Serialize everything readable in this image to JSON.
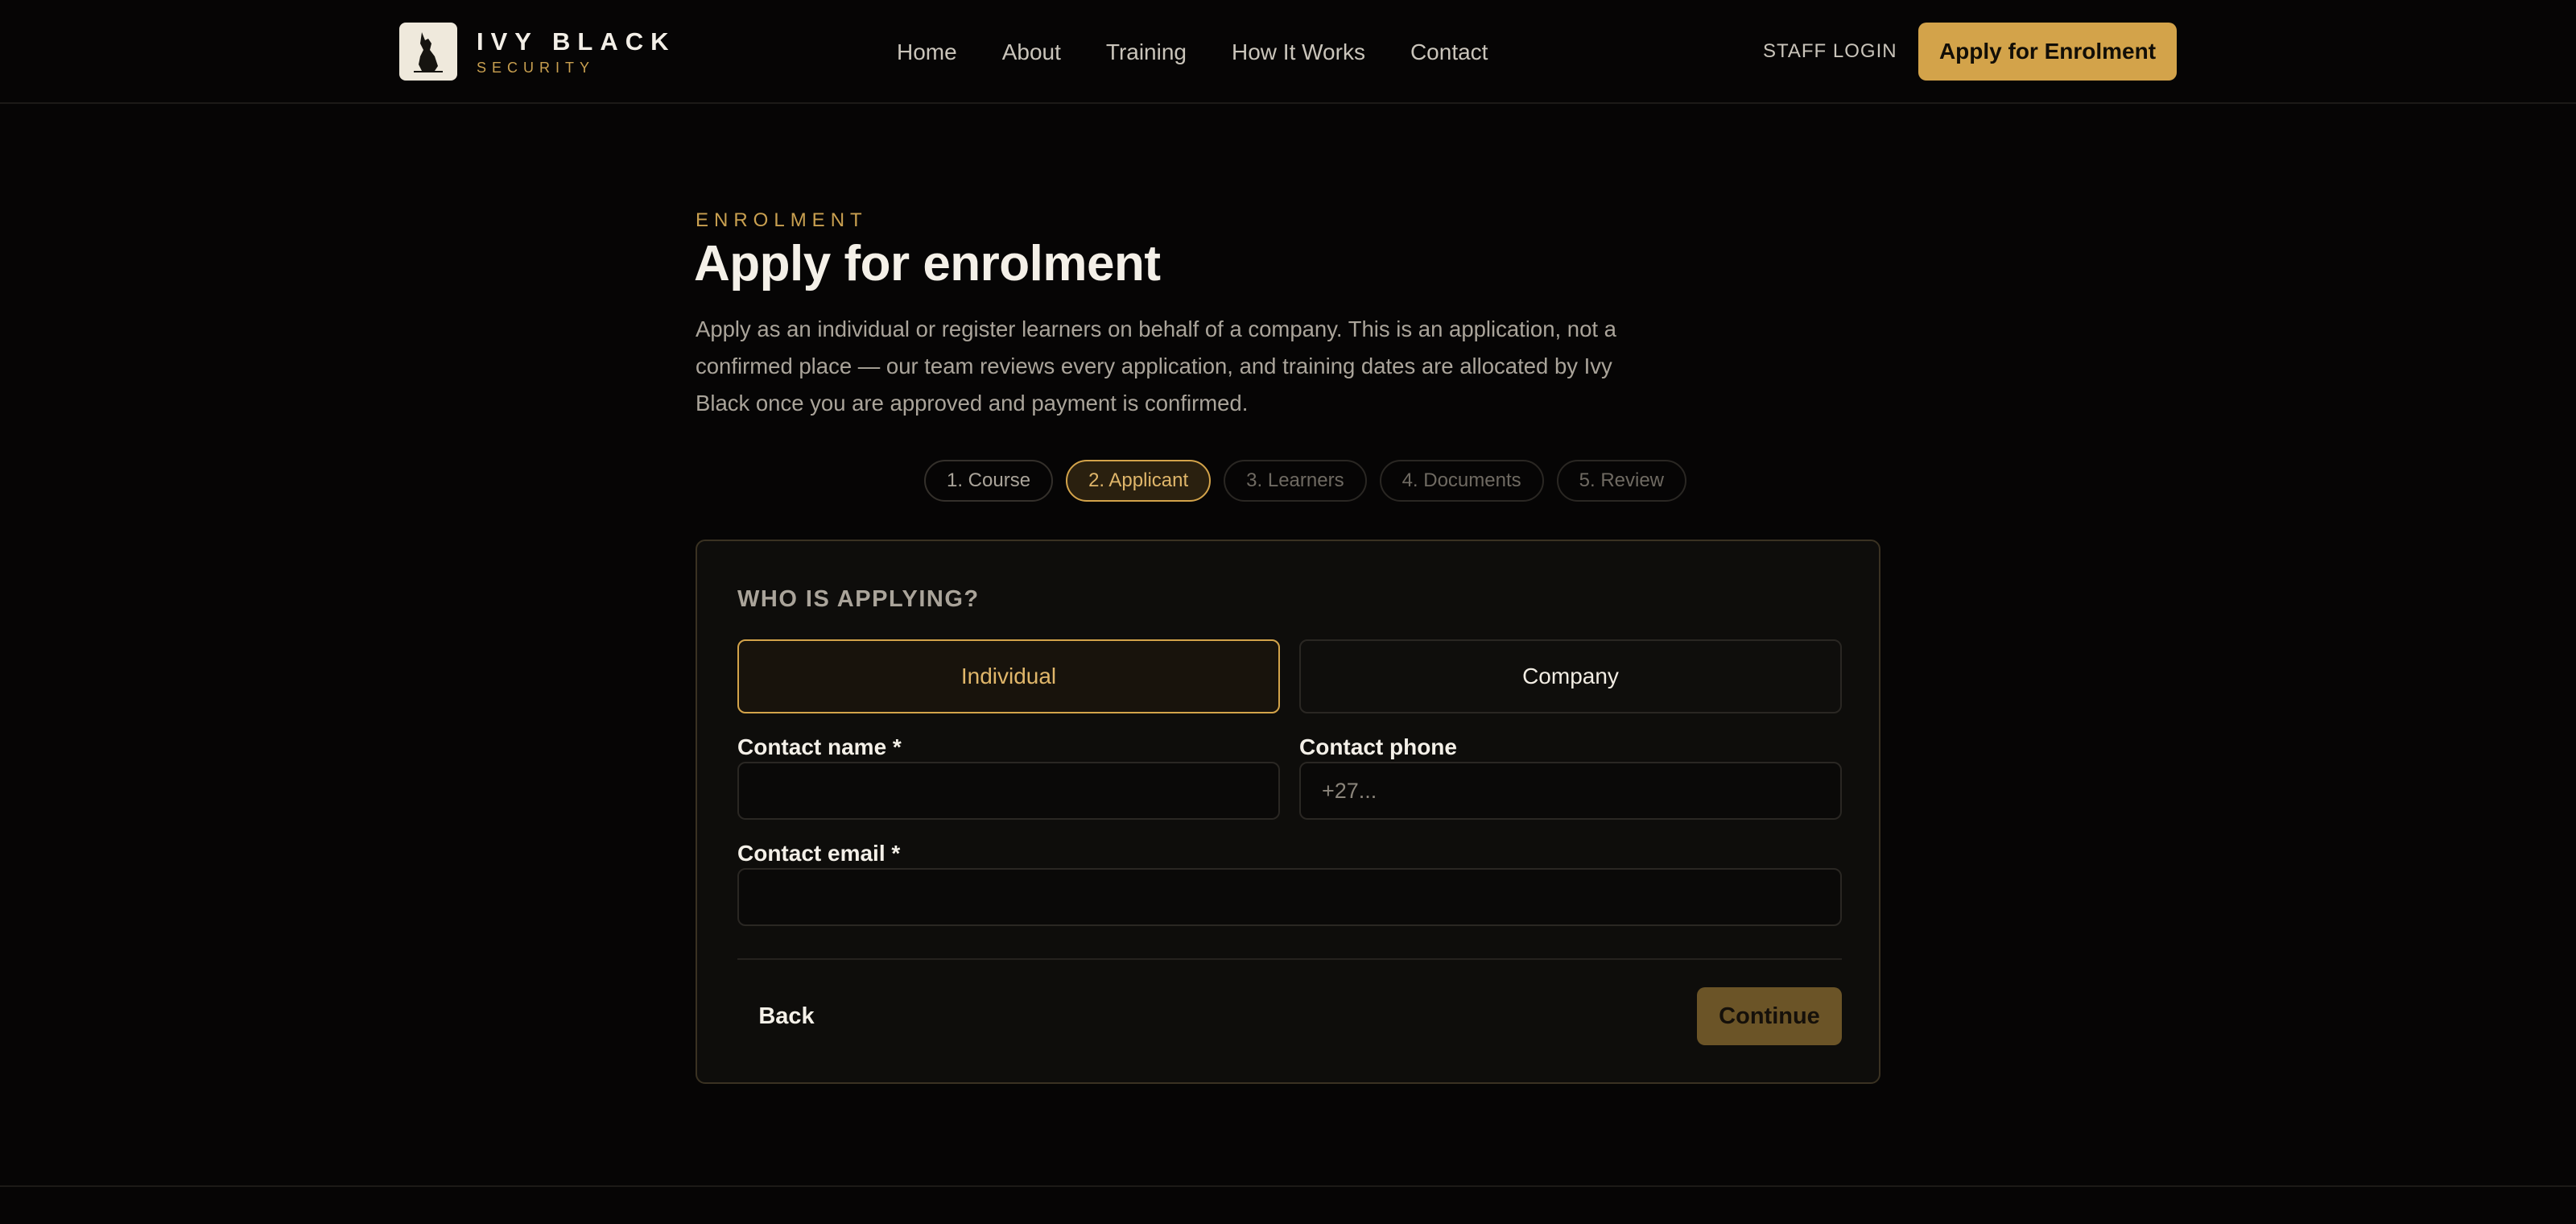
{
  "brand": {
    "name": "IVY BLACK",
    "tagline": "SECURITY",
    "logo_icon": "wolf-icon"
  },
  "nav": {
    "items": [
      "Home",
      "About",
      "Training",
      "How It Works",
      "Contact"
    ],
    "staff_login": "STAFF LOGIN",
    "apply_button": "Apply for Enrolment"
  },
  "intro": {
    "eyebrow": "ENROLMENT",
    "title": "Apply for enrolment",
    "description": "Apply as an individual or register learners on behalf of a company. This is an application, not a confirmed place — our team reviews every application, and training dates are allocated by Ivy Black once you are approved and payment is confirmed."
  },
  "steps": [
    {
      "label": "1. Course",
      "state": "done"
    },
    {
      "label": "2. Applicant",
      "state": "active"
    },
    {
      "label": "3. Learners",
      "state": "pending"
    },
    {
      "label": "4. Documents",
      "state": "pending"
    },
    {
      "label": "5. Review",
      "state": "pending"
    }
  ],
  "form": {
    "section_label": "WHO IS APPLYING?",
    "applicant_types": {
      "individual": "Individual",
      "company": "Company",
      "selected": "Individual"
    },
    "contact_name": {
      "label": "Contact name *",
      "value": "",
      "placeholder": ""
    },
    "contact_phone": {
      "label": "Contact phone",
      "value": "",
      "placeholder": "+27..."
    },
    "contact_email": {
      "label": "Contact email *",
      "value": "",
      "placeholder": ""
    },
    "back_label": "Back",
    "continue_label": "Continue"
  },
  "colors": {
    "accent": "#d3a34a",
    "background": "#060505",
    "card": "#0e0d0b"
  }
}
